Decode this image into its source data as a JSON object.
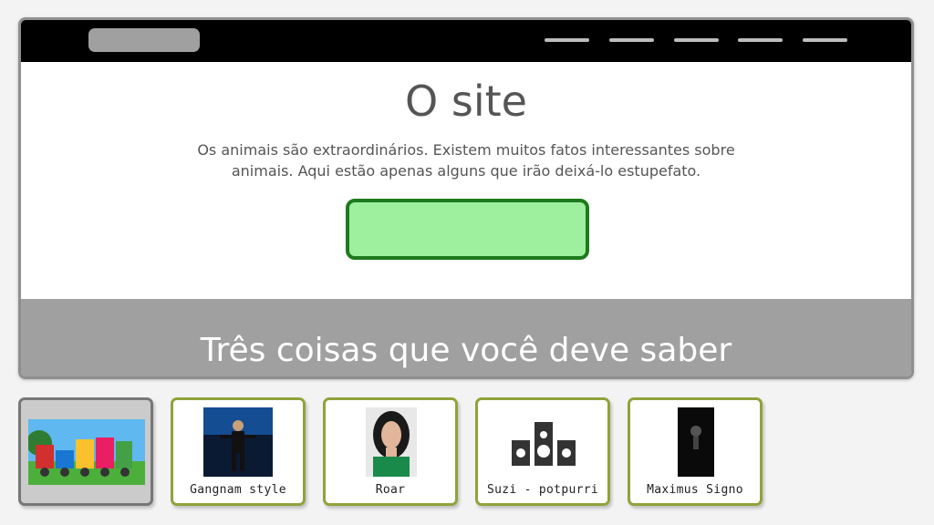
{
  "page": {
    "title": "O site",
    "intro": "Os animais são extraordinários.  Existem muitos fatos interessantes sobre animais.  Aqui estão apenas alguns que irão deixá-lo estupefato.",
    "section_title": "Três coisas que você deve saber"
  },
  "filmstrip": [
    {
      "label": "",
      "icon": "cartoon-train-thumbnail",
      "active": true
    },
    {
      "label": "Gangnam style",
      "icon": "dancer-thumbnail",
      "active": false
    },
    {
      "label": "Roar",
      "icon": "singer-portrait-thumbnail",
      "active": false
    },
    {
      "label": "Suzi - potpurri",
      "icon": "speaker-system-icon",
      "active": false
    },
    {
      "label": "Maximus Signo",
      "icon": "dark-album-thumbnail",
      "active": false
    }
  ],
  "colors": {
    "cta_fill": "#9eef9e",
    "cta_border": "#1e7a1e",
    "thumb_border": "#8ea33a",
    "band": "#a0a0a0"
  }
}
